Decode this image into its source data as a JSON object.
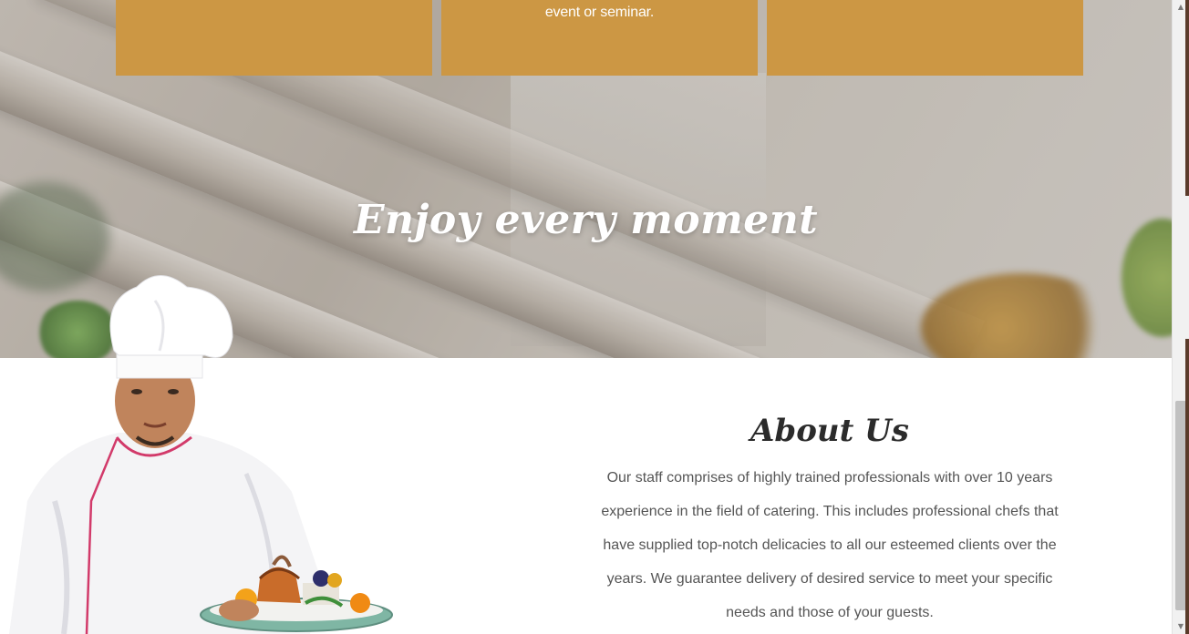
{
  "cards": [
    {
      "text": ""
    },
    {
      "text": "event or seminar."
    },
    {
      "text": ""
    }
  ],
  "hero": {
    "title": "Enjoy every moment"
  },
  "about": {
    "title": "About Us",
    "body": "Our staff comprises of highly trained professionals with over 10 years experience in the field of catering. This includes professional chefs that have supplied top-notch delicacies to all our esteemed clients over the years. We guarantee delivery of desired service to meet your specific needs and those of your guests."
  },
  "colors": {
    "card_accent": "#cc9744",
    "heading_dark": "#2b2b2b",
    "body_text": "#555555"
  },
  "icons": {
    "scroll_up": "triangle-up-icon",
    "scroll_down": "triangle-down-icon"
  }
}
